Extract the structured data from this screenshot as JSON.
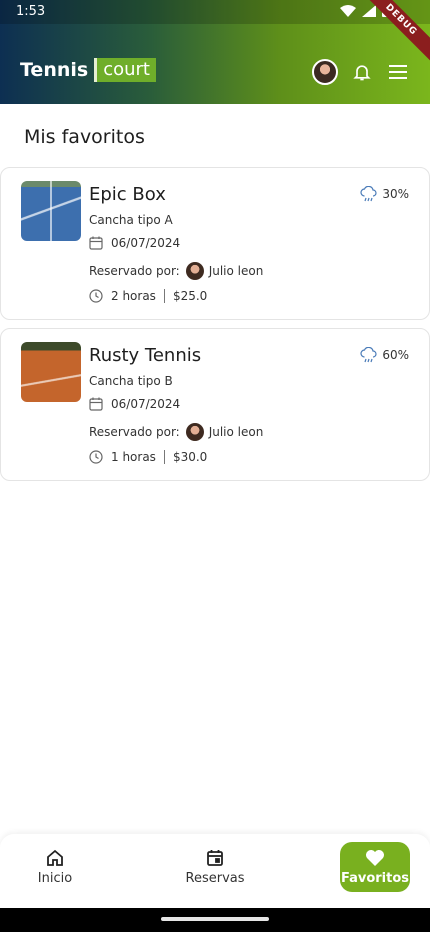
{
  "status_bar": {
    "time": "1:53",
    "debug_label": "DEBUG"
  },
  "header": {
    "brand_tennis": "Tennis",
    "brand_court": "court",
    "gradient_colors": [
      "#0d2f52",
      "#5e8f1a",
      "#7bb61c"
    ]
  },
  "page": {
    "title": "Mis favoritos"
  },
  "favorites": [
    {
      "name": "Epic Box",
      "type": "Cancha tipo A",
      "date": "06/07/2024",
      "reserved_label": "Reservado por:",
      "reserved_by": "Julio leon",
      "duration": "2 horas",
      "price": "$25.0",
      "rain_chance": "30%",
      "thumb": "blue hard court"
    },
    {
      "name": "Rusty Tennis",
      "type": "Cancha tipo B",
      "date": "06/07/2024",
      "reserved_label": "Reservado por:",
      "reserved_by": "Julio leon",
      "duration": "1 horas",
      "price": "$30.0",
      "rain_chance": "60%",
      "thumb": "clay court"
    }
  ],
  "bottom_nav": {
    "items": [
      {
        "label": "Inicio",
        "icon": "home-icon"
      },
      {
        "label": "Reservas",
        "icon": "calendar-icon"
      },
      {
        "label": "Favoritos",
        "icon": "heart-icon",
        "active": true
      }
    ],
    "active_color": "#79b01f"
  }
}
